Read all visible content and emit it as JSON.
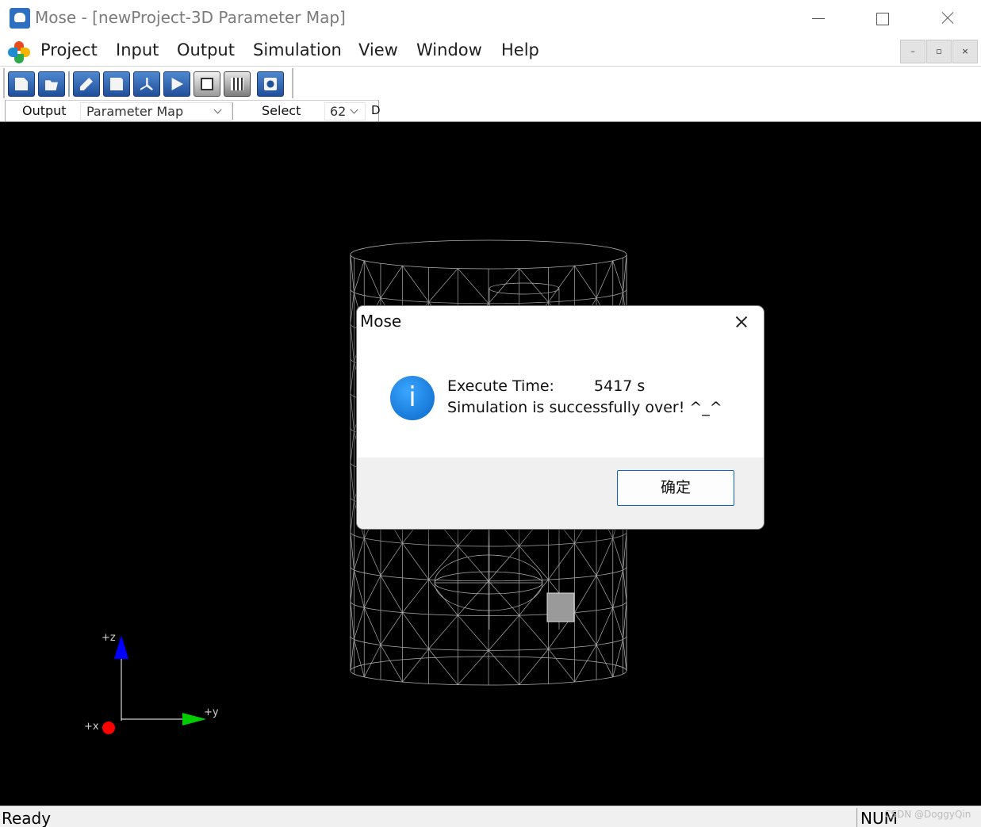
{
  "window": {
    "title": "Mose - [newProject-3D Parameter Map]"
  },
  "menu": {
    "items": [
      "Project",
      "Input",
      "Output",
      "Simulation",
      "View",
      "Window",
      "Help"
    ]
  },
  "toolbar": {
    "buttons": [
      "new-icon",
      "open-icon",
      "edit-icon",
      "save-icon",
      "axis-icon",
      "play-icon",
      "stop-icon",
      "grid-icon",
      "camera-icon"
    ]
  },
  "output_bar": {
    "output_label": "Output",
    "view_value": "Parameter Map",
    "select_label": "Select",
    "select_value": "62",
    "extra_value": "D"
  },
  "axes": {
    "z": "+z",
    "y": "+y",
    "x": "+x",
    "colors": {
      "z": "#0000ff",
      "y": "#00cc00",
      "x": "#ff0000"
    }
  },
  "dialog": {
    "title": "Mose",
    "execute_label": "Execute Time:",
    "execute_value": "5417 s",
    "message": "Simulation is successfully over! ^_^",
    "ok_label": "确定"
  },
  "status": {
    "ready": "Ready",
    "num": "NUM",
    "watermark": "CSDN @DoggyQin"
  }
}
